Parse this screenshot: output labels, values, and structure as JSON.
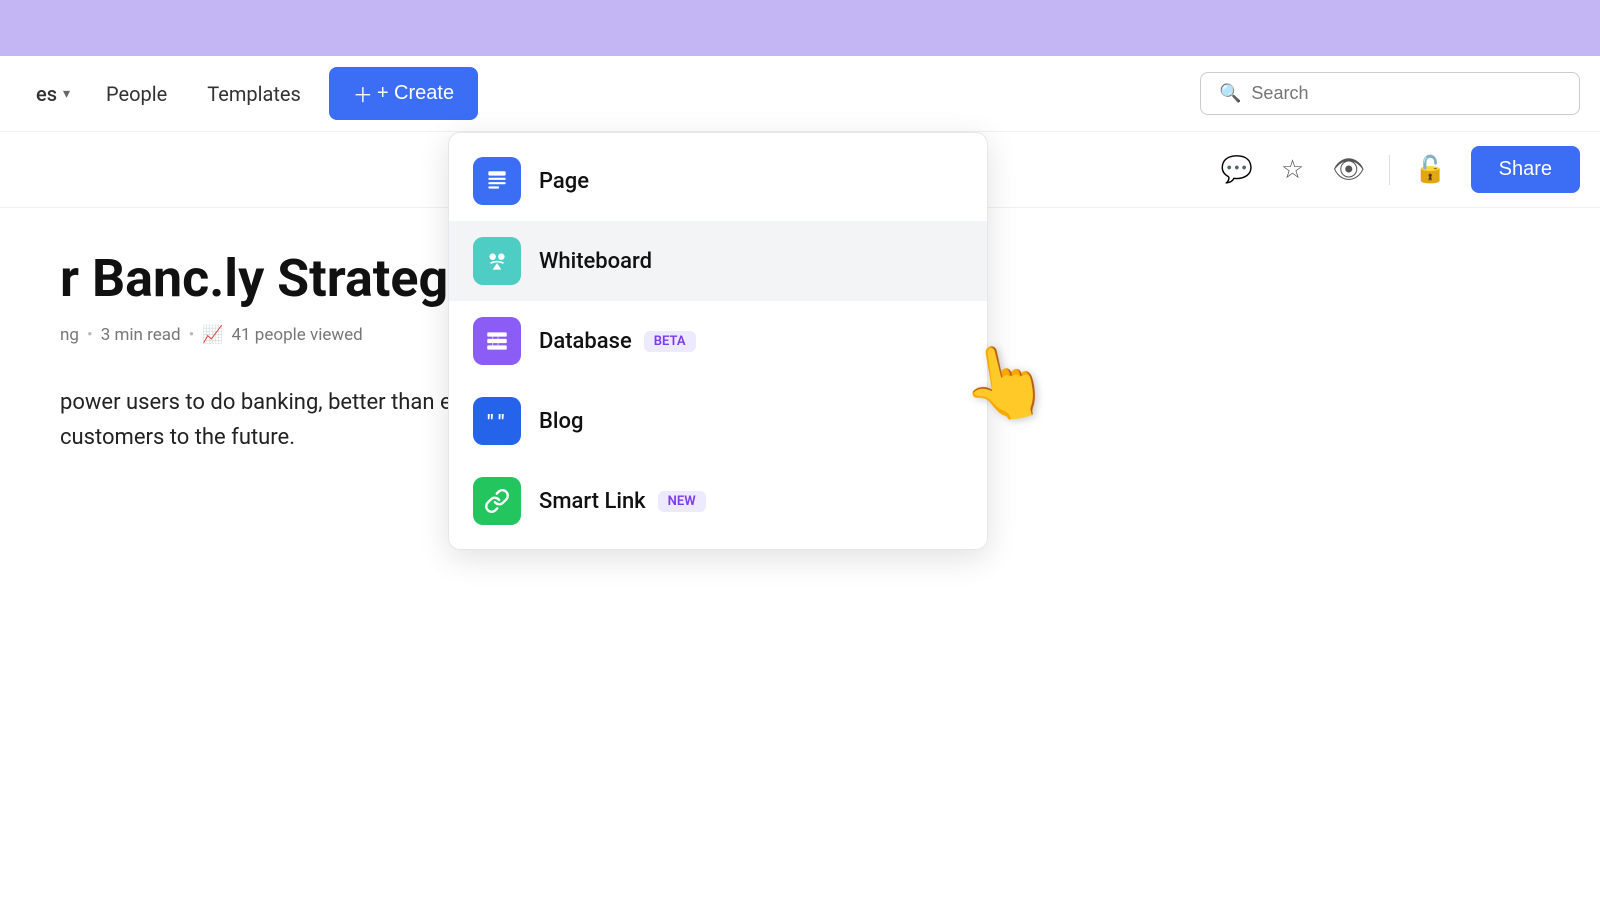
{
  "banner": {
    "color": "#c4b5f4"
  },
  "navbar": {
    "spaces_label": "es",
    "people_label": "People",
    "templates_label": "Templates",
    "create_label": "+ Create",
    "search_placeholder": "Search"
  },
  "toolbar": {
    "share_label": "Share"
  },
  "dropdown": {
    "items": [
      {
        "id": "page",
        "label": "Page",
        "icon_color": "blue",
        "icon": "page"
      },
      {
        "id": "whiteboard",
        "label": "Whiteboard",
        "icon_color": "teal",
        "icon": "whiteboard"
      },
      {
        "id": "database",
        "label": "Database",
        "icon_color": "purple",
        "icon": "database",
        "badge": "BETA",
        "badge_type": "beta"
      },
      {
        "id": "blog",
        "label": "Blog",
        "icon_color": "blog-blue",
        "icon": "blog"
      },
      {
        "id": "smartlink",
        "label": "Smart Link",
        "icon_color": "green",
        "icon": "smartlink",
        "badge": "NEW",
        "badge_type": "new"
      }
    ]
  },
  "page": {
    "title": "r Banc.ly Strategy",
    "meta_author": "ng",
    "meta_read": "3 min read",
    "meta_views": "41 people viewed",
    "body_text": "power users to do banking, better than ever. We are a credit card company to take our customers to the future."
  }
}
